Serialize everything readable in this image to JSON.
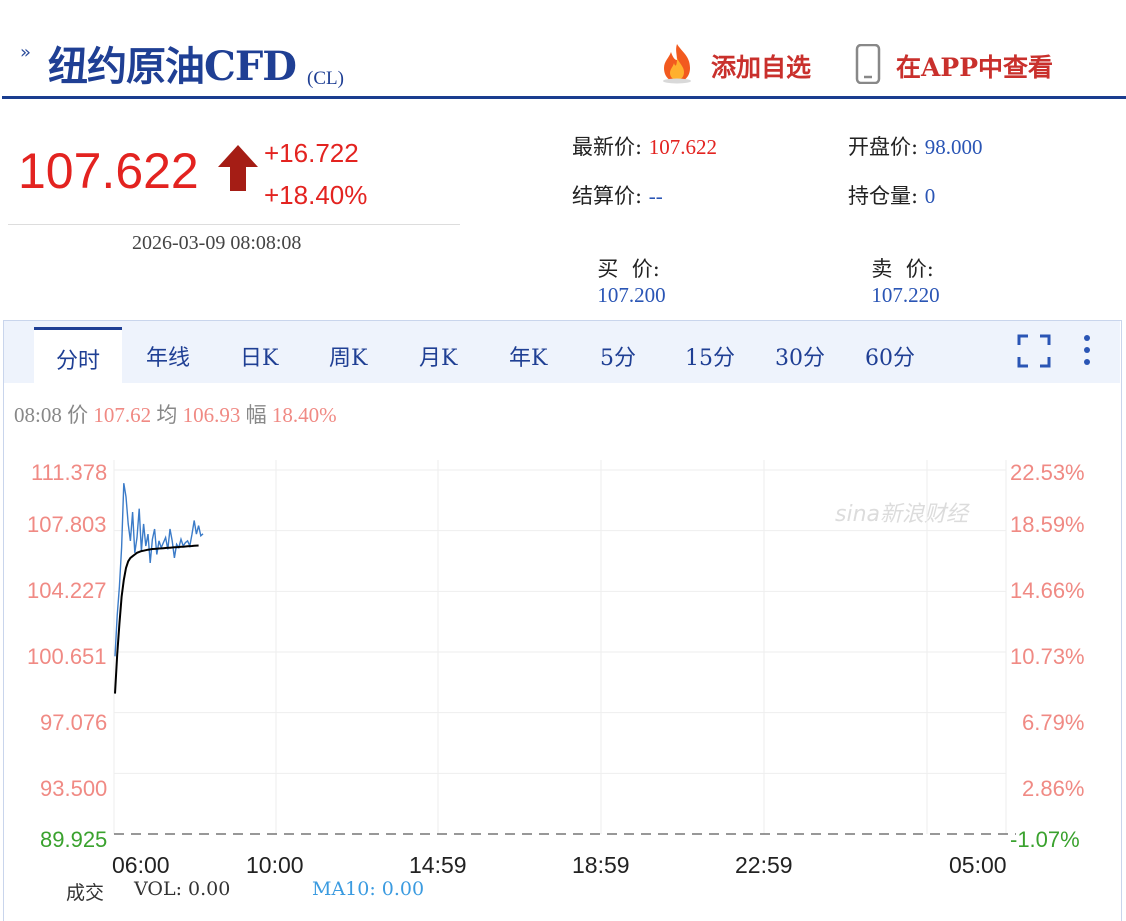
{
  "header": {
    "title": "纽约原油CFD",
    "code": "(CL)",
    "add_watch": "添加自选",
    "view_in_app": "在APP中查看"
  },
  "quote": {
    "price": "107.622",
    "change": "+16.722",
    "change_pct": "+18.40%",
    "timestamp": "2026-03-09 08:08:08",
    "fields": {
      "latest_label": "最新价:",
      "latest_value": "107.622",
      "open_label": "开盘价:",
      "open_value": "98.000",
      "settle_label": "结算价:",
      "settle_value": "--",
      "oi_label": "持仓量:",
      "oi_value": "0",
      "bid_label": "买  价:",
      "bid_value": "107.200",
      "ask_label": "卖  价:",
      "ask_value": "107.220"
    }
  },
  "tabs": [
    "分时",
    "年线",
    "日K",
    "周K",
    "月K",
    "年K",
    "5分",
    "15分",
    "30分",
    "60分"
  ],
  "info": {
    "time": "08:08",
    "price_label": "价",
    "price_value": "107.62",
    "avg_label": "均",
    "avg_value": "106.93",
    "amp_label": "幅",
    "amp_value": "18.40%"
  },
  "watermark": "sina新浪财经",
  "footer": {
    "vol": "VOL: 0.00",
    "ma": "MA10: 0.00",
    "deal": "成交"
  },
  "colors": {
    "up": "#e32320",
    "brand": "#1f3f94",
    "price_line": "#3b7bc8",
    "avg_line": "#000000"
  },
  "chart_data": {
    "type": "line",
    "y_left_ticks": [
      "111.378",
      "107.803",
      "104.227",
      "100.651",
      "97.076",
      "93.500",
      "89.925"
    ],
    "y_right_ticks": [
      "22.53%",
      "18.59%",
      "14.66%",
      "10.73%",
      "6.79%",
      "2.86%",
      "-1.07%"
    ],
    "x_ticks": [
      "06:00",
      "10:00",
      "14:59",
      "18:59",
      "22:59",
      "05:00"
    ],
    "ylim": [
      89.925,
      111.378
    ],
    "series": [
      {
        "values": [
          100.4,
          102.8,
          104.5,
          106.8,
          110.6,
          109.8,
          108.2,
          107.2,
          108.9,
          106.5,
          107.4,
          109.1,
          106.6,
          108.2,
          106.9,
          107.6,
          105.9,
          107.3,
          107.9,
          106.4,
          107.2,
          106.8,
          107.1,
          107.4,
          106.7,
          107.9,
          107.2,
          106.2,
          107.0,
          106.8,
          107.3,
          106.9,
          107.1,
          107.2,
          106.9,
          107.6,
          108.4,
          107.6,
          108.1,
          107.5,
          107.62
        ]
      },
      {
        "values": [
          98.2,
          100.5,
          102.3,
          103.9,
          104.9,
          105.6,
          106.0,
          106.2,
          106.3,
          106.4,
          106.5,
          106.55,
          106.6,
          106.62,
          106.65,
          106.68,
          106.7,
          106.72,
          106.73,
          106.74,
          106.75,
          106.76,
          106.77,
          106.78,
          106.79,
          106.8,
          106.81,
          106.82,
          106.83,
          106.84,
          106.85,
          106.86,
          106.87,
          106.88,
          106.89,
          106.9,
          106.91,
          106.92,
          106.93
        ]
      }
    ]
  }
}
